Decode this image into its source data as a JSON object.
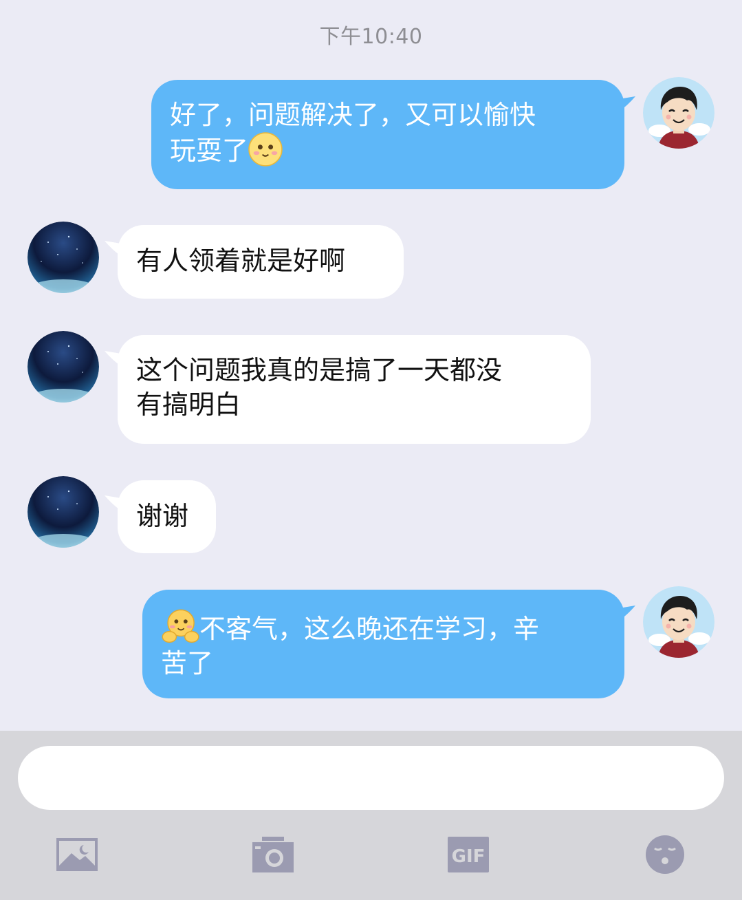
{
  "timestamp": "下午10:40",
  "messages": [
    {
      "direction": "out",
      "line1": "好了，问题解决了，又可以愉快",
      "line2": "玩耍了",
      "emoji": "shy-face-emoji"
    },
    {
      "direction": "in",
      "text": "有人领着就是好啊"
    },
    {
      "direction": "in",
      "line1": "这个问题我真的是搞了一天都没",
      "line2": "有搞明白"
    },
    {
      "direction": "in",
      "text": "谢谢"
    },
    {
      "direction": "out",
      "line1": "不客气，这么晚还在学习，辛",
      "line2": "苦了",
      "emoji": "hug-emoji"
    }
  ],
  "composer": {
    "placeholder": "",
    "value": ""
  },
  "toolbar": {
    "icons": [
      "image-icon",
      "camera-icon",
      "gif-icon",
      "sticker-face-icon"
    ],
    "gif_label": "GIF"
  },
  "colors": {
    "background": "#ebebf5",
    "outgoing_bubble": "#5eb7f8",
    "incoming_bubble": "#ffffff",
    "composer_bar": "#d6d6da",
    "toolbar_icon": "#9b9bb1"
  }
}
